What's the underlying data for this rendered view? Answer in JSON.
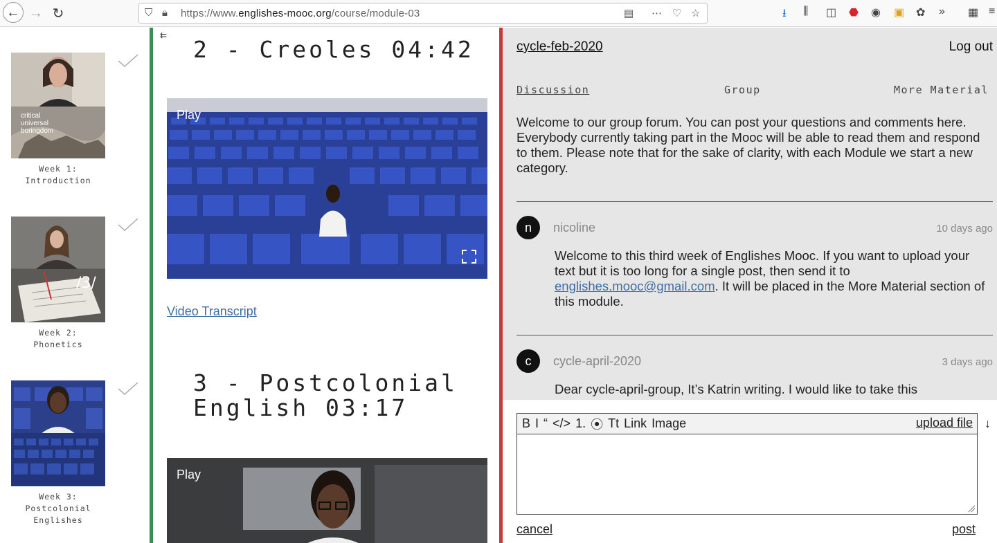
{
  "browser": {
    "url_prefix": "https://www.",
    "url_domain": "englishes-mooc.org",
    "url_path": "/course/module-03"
  },
  "sidebar": {
    "weeks": [
      {
        "label": "Week 1:\nIntroduction",
        "overlay": "critical\nuniversal\nboringdom",
        "completed": true
      },
      {
        "label": "Week 2:\nPhonetics",
        "overlay": "/3/",
        "completed": true
      },
      {
        "label": "Week 3:\nPostcolonial\nEnglishes",
        "overlay": "",
        "completed": true
      }
    ]
  },
  "videos": [
    {
      "title": "2 - Creoles 04:42",
      "play_label": "Play"
    },
    {
      "title": "3 - Postcolonial\nEnglish 03:17",
      "play_label": "Play"
    }
  ],
  "transcript_label": "Video Transcript",
  "forum": {
    "cycle_link": "cycle-feb-2020",
    "logout": "Log out",
    "tabs": [
      "Discussion",
      "Group",
      "More Material"
    ],
    "welcome": "Welcome to our group forum. You can post your questions and comments here. Everybody currently taking part in the Mooc will be able to read them and respond to them. Please note that for the sake of clarity, with each Module we start a new category.",
    "posts": [
      {
        "initial": "n",
        "author": "nicoline",
        "ago": "10 days ago",
        "body_before": "Welcome to this third week of Englishes Mooc. If you want to upload your text but it is too long for a single post, then send it to ",
        "email": "englishes.mooc@gmail.com",
        "body_after": ". It will be placed in the More Material section of this module."
      },
      {
        "initial": "c",
        "author": "cycle-april-2020",
        "ago": "3 days ago",
        "body_before": "Dear cycle-april-group, It’s Katrin writing. I would like to take this",
        "email": "",
        "body_after": ""
      }
    ]
  },
  "editor": {
    "tools": [
      "B",
      "I",
      "“",
      "</>",
      "1.",
      "⦿",
      "Tt",
      "Link",
      "Image"
    ],
    "upload": "upload file",
    "cancel": "cancel",
    "post": "post"
  }
}
